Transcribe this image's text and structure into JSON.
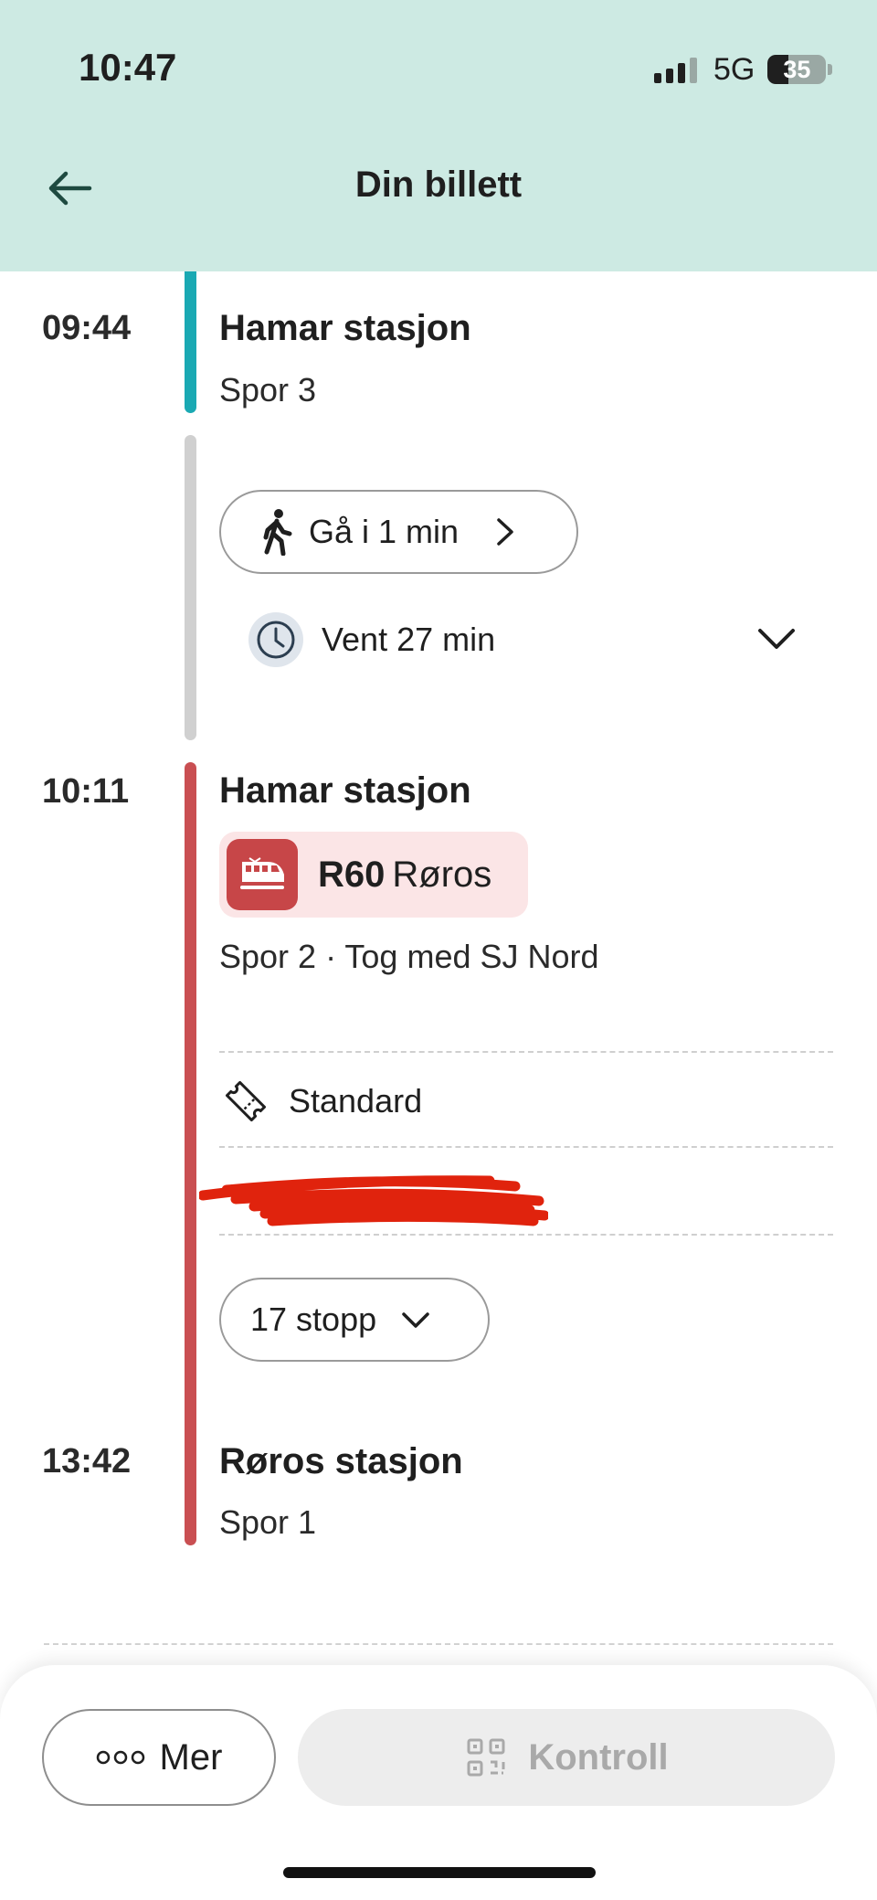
{
  "status_bar": {
    "time": "10:47",
    "network": "5G",
    "battery": "35",
    "battery_level": 0.35,
    "signal_bars": 3
  },
  "header": {
    "title": "Din billett",
    "background": "#cdeae3"
  },
  "journey": {
    "leg1": {
      "time": "09:44",
      "station": "Hamar stasjon",
      "platform": "Spor 3",
      "color": "#1aa9b3"
    },
    "transfer": {
      "walk_label": "Gå i 1 min",
      "wait_label": "Vent 27 min",
      "color": "#d0d0d0"
    },
    "leg2": {
      "time": "10:11",
      "station": "Hamar stasjon",
      "line_code": "R60",
      "line_destination": "Røros",
      "details": "Spor 2 · Tog med SJ Nord",
      "fare_class": "Standard",
      "stops_label": "17 stopp",
      "color": "#c94f52"
    },
    "arrival": {
      "time": "13:42",
      "station": "Røros stasjon",
      "platform": "Spor 1"
    }
  },
  "actions": {
    "more_label": "Mer",
    "control_label": "Kontroll"
  },
  "icons": [
    "back-arrow-icon",
    "walk-icon",
    "chevron-right-icon",
    "clock-icon",
    "chevron-down-icon",
    "train-icon",
    "ticket-icon",
    "more-dots-icon",
    "qr-code-icon"
  ]
}
